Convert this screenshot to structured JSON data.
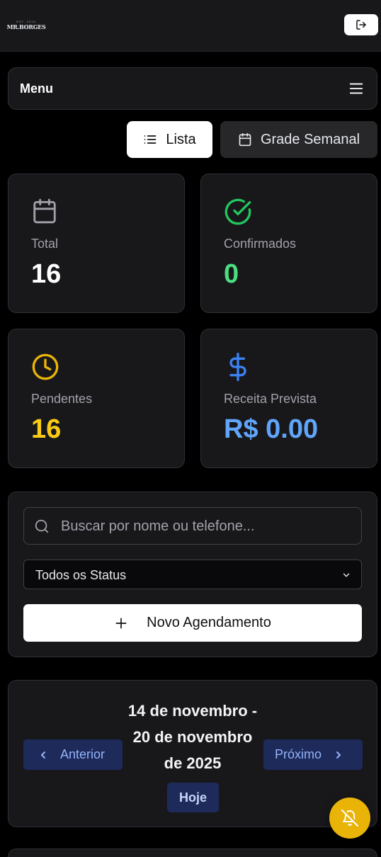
{
  "header": {
    "logo_top": "EST. 2019",
    "logo_brand": "MR.BORGES",
    "logout_icon": "logout-icon"
  },
  "menu": {
    "label": "Menu",
    "icon": "hamburger-icon"
  },
  "view_toggle": {
    "list_label": "Lista",
    "weekly_label": "Grade Semanal"
  },
  "stats": {
    "total": {
      "label": "Total",
      "value": "16",
      "color": "#ffffff"
    },
    "confirmed": {
      "label": "Confirmados",
      "value": "0",
      "color": "#4ade80"
    },
    "pending": {
      "label": "Pendentes",
      "value": "16",
      "color": "#facc15"
    },
    "revenue": {
      "label": "Receita Prevista",
      "value": "R$ 0.00",
      "color": "#60a5fa"
    }
  },
  "filters": {
    "search_placeholder": "Buscar por nome ou telefone...",
    "status_selected": "Todos os Status",
    "new_button": "Novo Agendamento"
  },
  "week_nav": {
    "range_line1": "14 de novembro -",
    "range_line2": "20 de novembro",
    "range_line3": "de 2025",
    "prev_label": "Anterior",
    "next_label": "Próximo",
    "today_label": "Hoje"
  },
  "colors": {
    "accent_yellow": "#eab308",
    "accent_blue_bg": "#1e2a5a",
    "card_bg": "#18181b"
  }
}
